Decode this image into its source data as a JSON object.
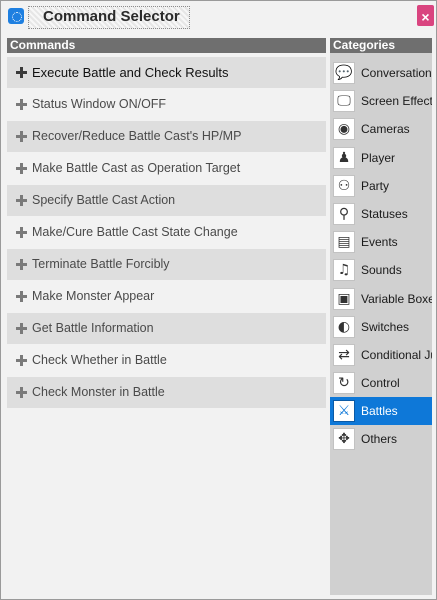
{
  "window": {
    "title": "Command Selector",
    "close_glyph": "×"
  },
  "commands": {
    "header": "Commands",
    "items": [
      {
        "label": "Execute Battle and Check Results"
      },
      {
        "label": "Status Window ON/OFF"
      },
      {
        "label": "Recover/Reduce Battle Cast's HP/MP"
      },
      {
        "label": "Make Battle Cast as Operation Target"
      },
      {
        "label": "Specify Battle Cast Action"
      },
      {
        "label": "Make/Cure Battle Cast State Change"
      },
      {
        "label": "Terminate Battle Forcibly"
      },
      {
        "label": "Make Monster Appear"
      },
      {
        "label": "Get Battle Information"
      },
      {
        "label": "Check Whether in Battle"
      },
      {
        "label": "Check Monster in Battle"
      }
    ]
  },
  "categories": {
    "header": "Categories",
    "selected": "Battles",
    "items": [
      {
        "label": "Conversation",
        "icon": "speech-bubble-icon",
        "glyph": "💬"
      },
      {
        "label": "Screen Effects",
        "icon": "monitor-icon",
        "glyph": "🖵"
      },
      {
        "label": "Cameras",
        "icon": "camera-icon",
        "glyph": "◉"
      },
      {
        "label": "Player",
        "icon": "player-icon",
        "glyph": "♟"
      },
      {
        "label": "Party",
        "icon": "party-icon",
        "glyph": "⚇"
      },
      {
        "label": "Statuses",
        "icon": "status-icon",
        "glyph": "⚲"
      },
      {
        "label": "Events",
        "icon": "events-icon",
        "glyph": "▤"
      },
      {
        "label": "Sounds",
        "icon": "music-note-icon",
        "glyph": "♫"
      },
      {
        "label": "Variable Boxes",
        "icon": "variable-box-icon",
        "glyph": "▣"
      },
      {
        "label": "Switches",
        "icon": "switch-icon",
        "glyph": "◐"
      },
      {
        "label": "Conditional Jumps",
        "icon": "conditional-icon",
        "glyph": "⇄"
      },
      {
        "label": "Control",
        "icon": "control-icon",
        "glyph": "↻"
      },
      {
        "label": "Battles",
        "icon": "crossed-swords-icon",
        "glyph": "⚔"
      },
      {
        "label": "Others",
        "icon": "others-icon",
        "glyph": "✥"
      }
    ]
  },
  "colors": {
    "selected": "#0e78d8",
    "close": "#d9447f",
    "header": "#6f6f6f"
  }
}
